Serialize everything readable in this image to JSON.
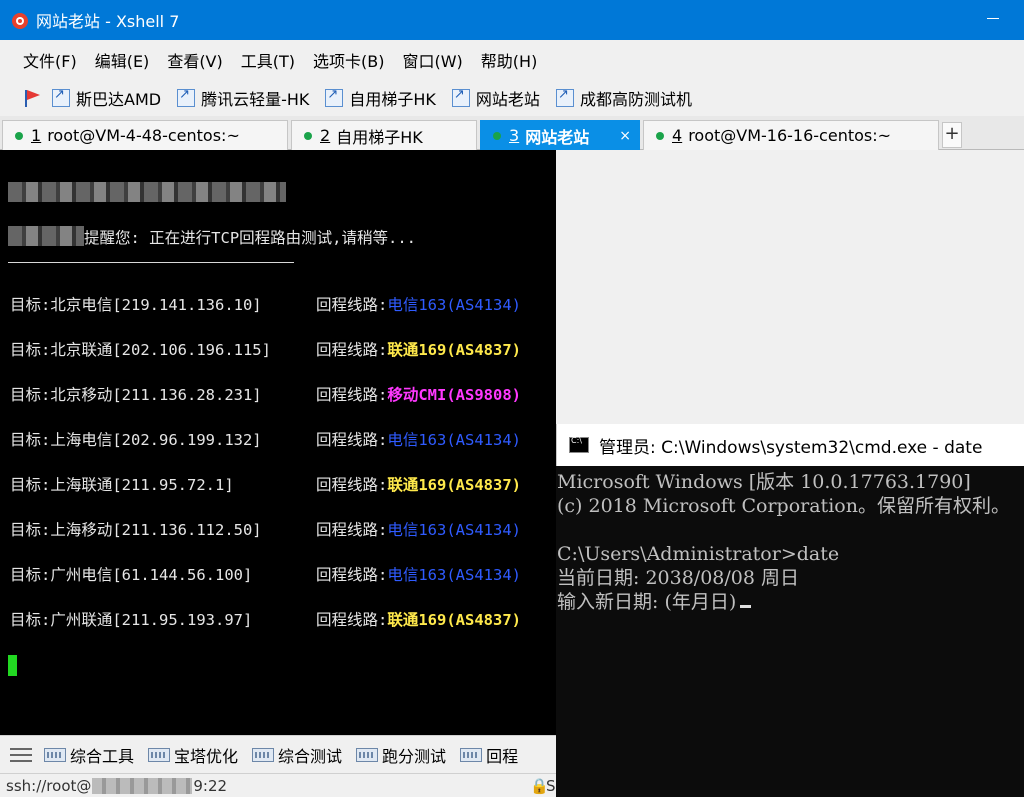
{
  "window": {
    "title": "网站老站 - Xshell 7"
  },
  "menu": [
    "文件(F)",
    "编辑(E)",
    "查看(V)",
    "工具(T)",
    "选项卡(B)",
    "窗口(W)",
    "帮助(H)"
  ],
  "quick_links": [
    "斯巴达AMD",
    "腾讯云轻量-HK",
    "自用梯子HK",
    "网站老站",
    "成都高防测试机"
  ],
  "tabs": [
    {
      "num": "1",
      "label": "root@VM-4-48-centos:~"
    },
    {
      "num": "2",
      "label": "自用梯子HK"
    },
    {
      "num": "3",
      "label": "网站老站"
    },
    {
      "num": "4",
      "label": "root@VM-16-16-centos:~"
    }
  ],
  "tab_add": "+",
  "tab_close": "×",
  "terminal": {
    "notice": "提醒您: 正在进行TCP回程路由测试,请稍等...",
    "route_label": "回程线路:",
    "rows": [
      {
        "target": "目标:北京电信[219.141.136.10]",
        "route": "电信163(AS4134)",
        "color": "blue"
      },
      {
        "target": "目标:北京联通[202.106.196.115]",
        "route": "联通169(AS4837)",
        "color": "yellow"
      },
      {
        "target": "目标:北京移动[211.136.28.231]",
        "route": "移动CMI(AS9808)",
        "color": "magenta"
      },
      {
        "target": "目标:上海电信[202.96.199.132]",
        "route": "电信163(AS4134)",
        "color": "blue"
      },
      {
        "target": "目标:上海联通[211.95.72.1]",
        "route": "联通169(AS4837)",
        "color": "yellow"
      },
      {
        "target": "目标:上海移动[211.136.112.50]",
        "route": "电信163(AS4134)",
        "color": "blue"
      },
      {
        "target": "目标:广州电信[61.144.56.100]",
        "route": "电信163(AS4134)",
        "color": "blue"
      },
      {
        "target": "目标:广州联通[211.95.193.97]",
        "route": "联通169(AS4837)",
        "color": "yellow"
      }
    ]
  },
  "bottom_tools": [
    "综合工具",
    "宝塔优化",
    "综合测试",
    "跑分测试",
    "回程"
  ],
  "status": {
    "prefix": "ssh://root@",
    "suffix": "9:22",
    "right": "S"
  },
  "cmd": {
    "title": "管理员: C:\\Windows\\system32\\cmd.exe - date",
    "lines": [
      "Microsoft Windows [版本 10.0.17763.1790]",
      "(c) 2018 Microsoft Corporation。保留所有权利。",
      "",
      "C:\\Users\\Administrator>date",
      "当前日期: 2038/08/08 周日",
      "输入新日期: (年月日)"
    ]
  },
  "colors": {
    "accent": "#0078d7",
    "tab_active": "#0a8fe6",
    "route_blue": "#2f5bff",
    "route_yellow": "#ffe94b",
    "route_magenta": "#ff38ff",
    "cursor": "#22d922"
  }
}
